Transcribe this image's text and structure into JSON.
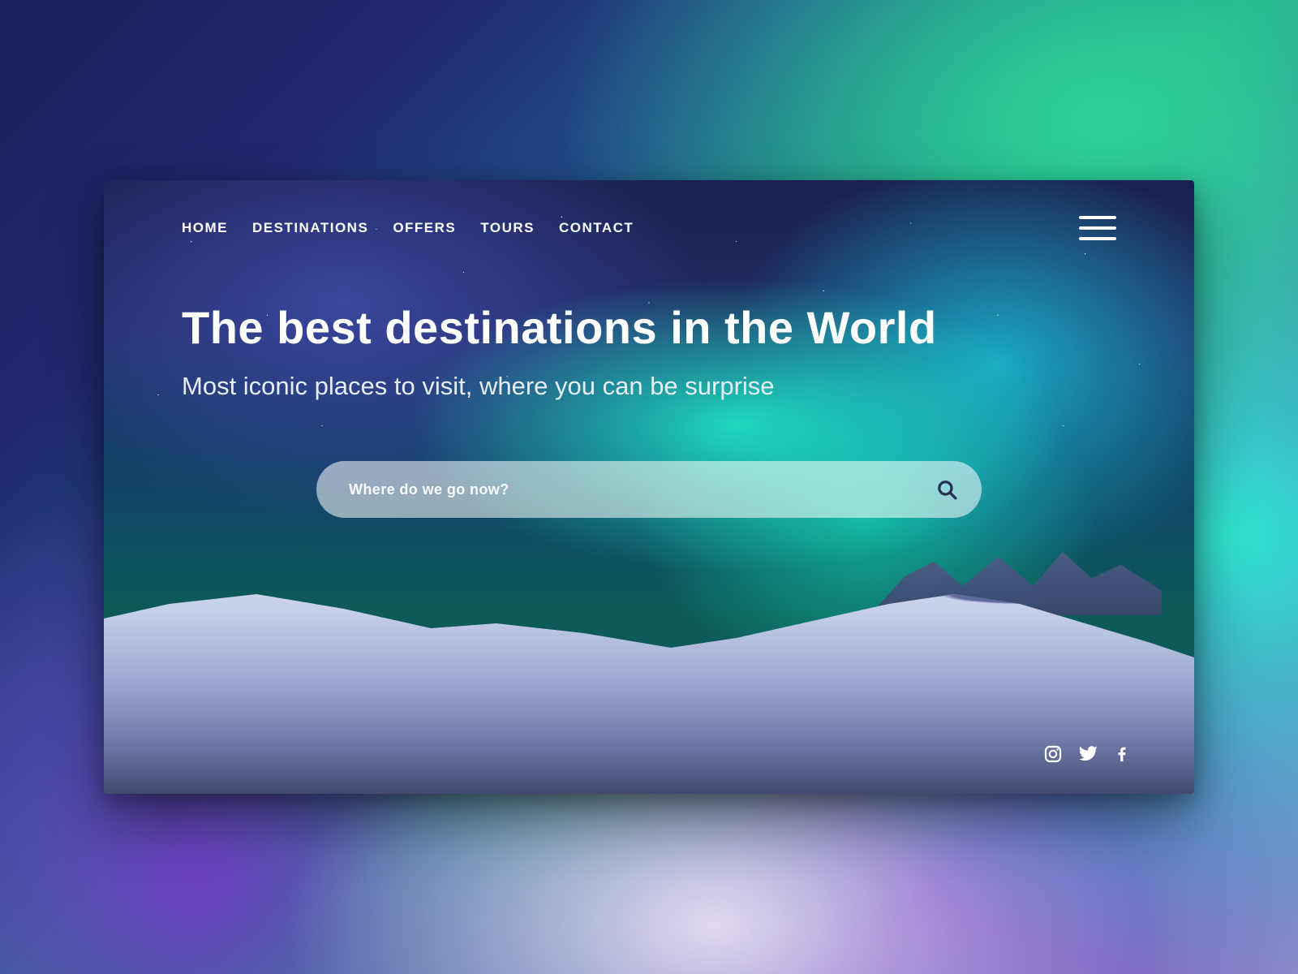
{
  "nav": {
    "items": [
      "HOME",
      "DESTINATIONS",
      "OFFERS",
      "TOURS",
      "CONTACT"
    ]
  },
  "hero": {
    "title": "The best destinations in the World",
    "subtitle": "Most iconic places to visit, where you can be surprise"
  },
  "search": {
    "placeholder": "Where do we go now?"
  },
  "social": {
    "items": [
      "instagram",
      "twitter",
      "facebook"
    ]
  },
  "icons": {
    "menu": "menu-icon",
    "search": "search-icon"
  },
  "colors": {
    "text": "#ffffff",
    "searchIcon": "#283055"
  }
}
